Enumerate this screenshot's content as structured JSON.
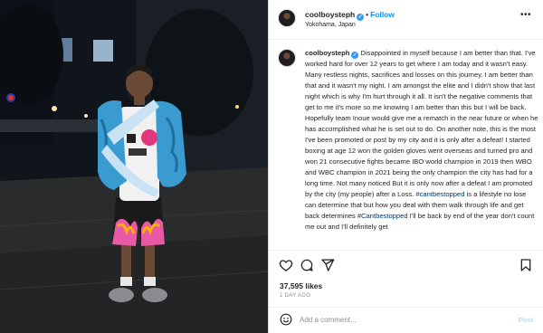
{
  "post": {
    "username": "coolboysteph",
    "follow_label": "Follow",
    "location": "Yokohama, Japan",
    "more_icon": "ellipsis-icon",
    "verified_icon": "verified-badge-icon",
    "caption_username": "coolboysteph",
    "caption_text_1": "Disappointed in myself because I am better than that. I've worked hard for over 12 years to get where I am today and it wasn't easy. Many restless nights, sacrifices and losses on this journey. I am better than that and it wasn't my night. I am amongst the elite and I didn't show that last night which is why I'm hurt through it all. It isn't the negative comments that get to me it's more so me knowing I am better than this but I will be back. Hopefully team Inoue would give me a rematch in the near future or when he has accomplished what he is set out to do. On another note, this is the most I've been promoted or post by my city and it is only after a defeat! I started boxing at age 12 won the golden gloves went overseas and turned pro and won 21 consecutive fights became IBO world champion in 2019 then WBO and WBC champion in 2021 being the only champion the city has had for a long time. Not many noticed But it is only now after a defeat I am promoted by the city (my people) after a Loss. ",
    "hashtag_1": "#cantbestopped",
    "caption_text_2": " is a lifestyle no lose can determine that but how you deal with them walk through life and get back determines ",
    "hashtag_2": "#Cantbestopped",
    "caption_text_3": " I'll be back by end of the year don't count me out and I'll definitely get",
    "likes": "37,595 likes",
    "time_ago": "1 DAY AGO",
    "comment_placeholder": "Add a comment...",
    "post_button": "Post"
  },
  "icons": [
    "heart-icon",
    "comment-icon",
    "share-icon",
    "bookmark-icon",
    "emoji-icon"
  ],
  "colors": {
    "link": "#0095f6",
    "hashtag": "#00376b",
    "verified": "#3897f0",
    "muted": "#8e8e8e"
  }
}
